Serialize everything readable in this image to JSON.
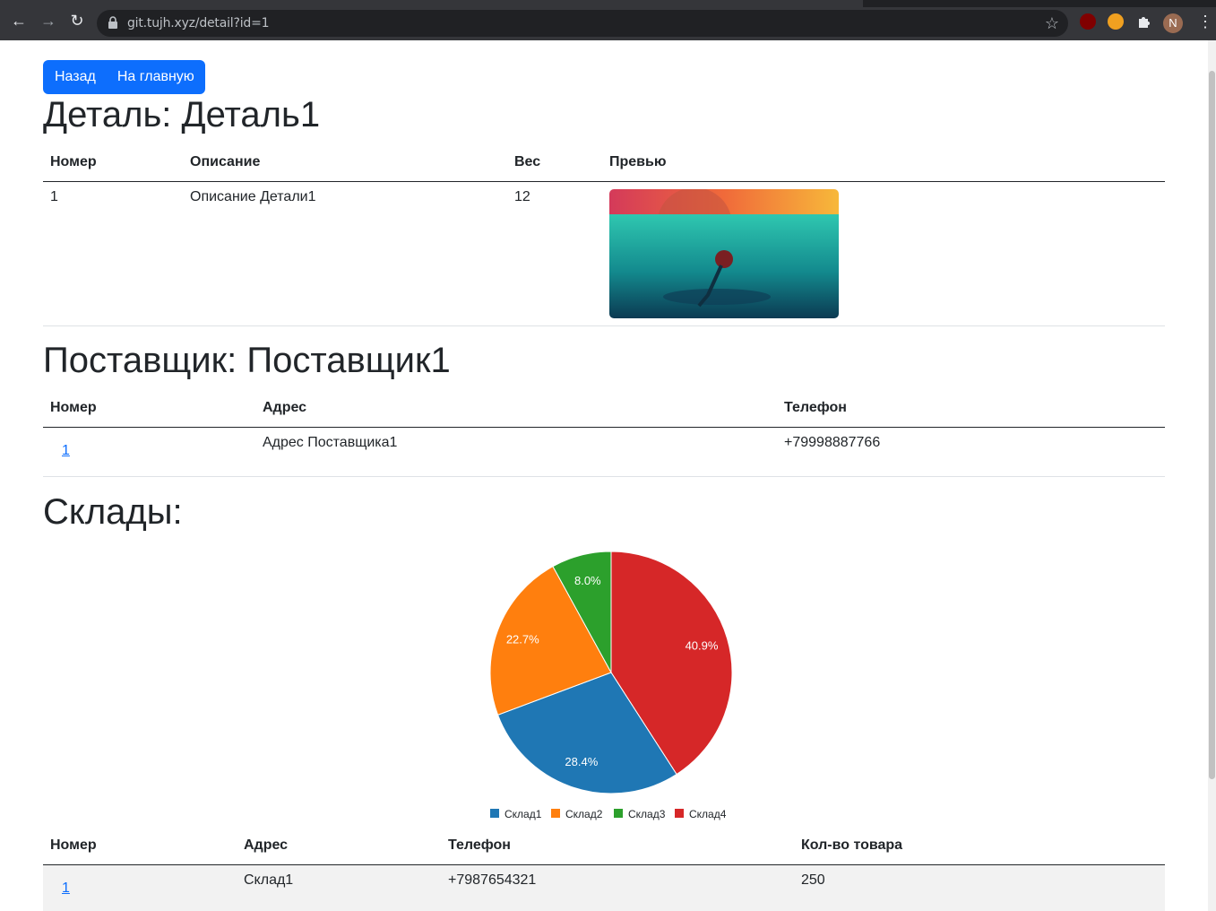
{
  "browser": {
    "url": "git.tujh.xyz/detail?id=1",
    "avatar_letter": "N"
  },
  "nav": {
    "back_label": "Назад",
    "home_label": "На главную"
  },
  "detail": {
    "heading": "Деталь: Деталь1",
    "columns": [
      "Номер",
      "Описание",
      "Вес",
      "Превью"
    ],
    "row": {
      "number": "1",
      "description": "Описание Детали1",
      "weight": "12"
    }
  },
  "supplier": {
    "heading": "Поставщик: Поставщик1",
    "columns": [
      "Номер",
      "Адрес",
      "Телефон"
    ],
    "row": {
      "number": "1",
      "address": "Адрес Поставщика1",
      "phone": "+79998887766"
    }
  },
  "warehouses": {
    "heading": "Склады:",
    "columns": [
      "Номер",
      "Адрес",
      "Телефон",
      "Кол-во товара"
    ],
    "rows": [
      {
        "number": "1",
        "address": "Склад1",
        "phone": "+7987654321",
        "quantity": "250"
      }
    ]
  },
  "chart_data": {
    "type": "pie",
    "categories": [
      "Склад1",
      "Склад2",
      "Склад3",
      "Склад4"
    ],
    "values": [
      28.4,
      22.7,
      8.0,
      40.9
    ],
    "labels": [
      "28.4%",
      "22.7%",
      "8.0%",
      "40.9%"
    ],
    "colors": [
      "#1f77b4",
      "#ff7f0e",
      "#2ca02c",
      "#d62728"
    ],
    "title": "",
    "legend": "bottom"
  }
}
